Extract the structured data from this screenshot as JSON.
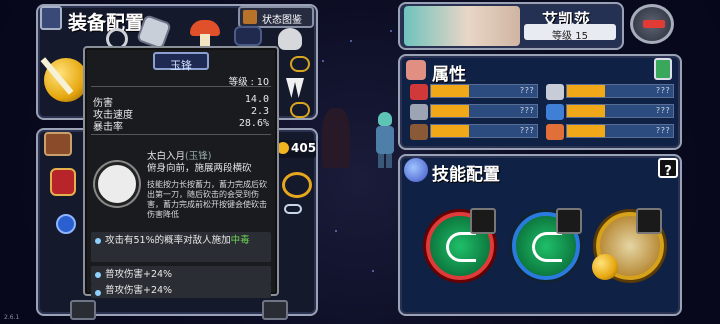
{
  "equipment_panel": {
    "title": "装备配置",
    "status_book": "状态图鉴",
    "gold": "405"
  },
  "character": {
    "name": "艾凯莎",
    "level": "等级 15"
  },
  "attributes": {
    "title": "属性",
    "bars": [
      {
        "icon": "heart-icon",
        "fill": 0.36,
        "value": "???"
      },
      {
        "icon": "sword-icon",
        "fill": 0.36,
        "value": "???"
      },
      {
        "icon": "shield-icon",
        "fill": 0.36,
        "value": "???"
      },
      {
        "icon": "eye-icon",
        "fill": 0.36,
        "value": "???"
      },
      {
        "icon": "boot-icon",
        "fill": 0.36,
        "value": "???"
      },
      {
        "icon": "flame-icon",
        "fill": 0.36,
        "value": "???"
      }
    ]
  },
  "skills": {
    "title": "技能配置",
    "help": "?"
  },
  "tooltip": {
    "name": "玉锋",
    "level": "等级 : 10",
    "stats": [
      {
        "label": "伤害",
        "value": "14.0"
      },
      {
        "label": "攻击速度",
        "value": "2.3"
      },
      {
        "label": "暴击率",
        "value": "28.6%"
      }
    ],
    "skill_name": "太白入月",
    "skill_source": "(玉锋)",
    "skill_desc": "俯身向前，施展两段横砍",
    "skill_detail": "技能按力长按蓄力，蓄力完成后砍出第一刀，随后砍击的会受到伤害，蓄力完成前松开按键会使砍击伤害降低",
    "bonuses": [
      {
        "text": "攻击有51%的概率对敌人施加",
        "extra": "中毒"
      },
      {
        "text": "普攻伤害+24%",
        "extra": ""
      },
      {
        "text": "普攻伤害+24%",
        "extra": ""
      }
    ]
  },
  "version": "2.6.1"
}
